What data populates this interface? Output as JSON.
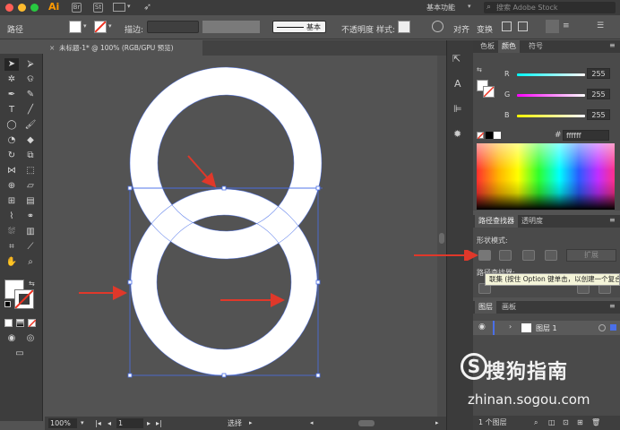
{
  "app": {
    "logo": "Ai",
    "workspace": "基本功能",
    "stock_search_placeholder": "搜索 Adobe Stock",
    "bridge_icon": "Br",
    "stock_icon": "St"
  },
  "control_bar": {
    "selection_type": "路径",
    "stroke_label": "描边:",
    "stroke_style": "基本",
    "opacity_label": "不透明度",
    "style_label": "样式:",
    "align_label": "对齐",
    "transform_label": "变换"
  },
  "document": {
    "tab_title": "未标题-1* @ 100% (RGB/GPU 预览)"
  },
  "status_bar": {
    "zoom": "100%",
    "artboard": "1",
    "tool_name": "选择"
  },
  "color_panel": {
    "tabs": [
      "色板",
      "颜色",
      "符号"
    ],
    "active_tab": "颜色",
    "channels": [
      {
        "label": "R",
        "value": "255",
        "color": "#ff3030"
      },
      {
        "label": "G",
        "value": "255",
        "color": "#30ff30"
      },
      {
        "label": "B",
        "value": "255",
        "color": "#3030ff"
      }
    ],
    "hex_symbol": "#",
    "hex": "ffffff"
  },
  "pathfinder_panel": {
    "tabs": [
      "路径查找器",
      "透明度"
    ],
    "shape_modes_label": "形状模式:",
    "expand_label": "扩展",
    "pathfinders_label": "路径查找器:",
    "tooltip": "联集 (按住 Option 键单击，以创建一个复合形状)"
  },
  "layers_panel": {
    "tabs": [
      "图层",
      "画板"
    ],
    "layer_name": "图层 1",
    "footer_count": "1 个图层"
  },
  "watermark": {
    "brand": "搜狗指南",
    "url": "zhinan.sogou.com",
    "logo_letter": "S"
  },
  "colors": {
    "ring_fill": "#ffffff",
    "selection": "#4a6fe8",
    "arrow": "#e0382a",
    "accent_logo": "#ff9a00"
  }
}
